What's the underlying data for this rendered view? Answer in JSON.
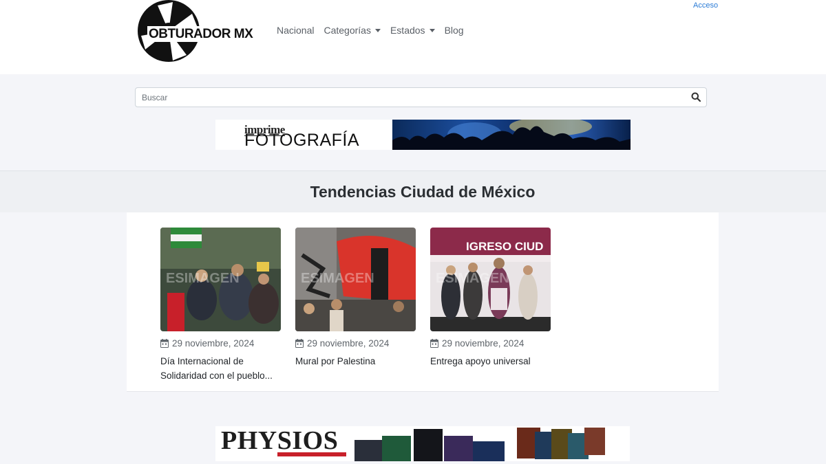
{
  "header": {
    "logo_text": "OBTURADOR MX",
    "login_label": "Acceso",
    "nav": [
      {
        "label": "Nacional",
        "has_dropdown": false
      },
      {
        "label": "Categorías",
        "has_dropdown": true
      },
      {
        "label": "Estados",
        "has_dropdown": true
      },
      {
        "label": "Blog",
        "has_dropdown": false
      }
    ]
  },
  "search": {
    "placeholder": "Buscar",
    "value": ""
  },
  "banners": {
    "top": {
      "small_text": "imprime",
      "big_text": "FOTOGRAFÍA"
    },
    "bottom": {
      "brand_text": "PHYSIOS"
    }
  },
  "section": {
    "title": "Tendencias Ciudad de México"
  },
  "cards": [
    {
      "date": "29 noviembre, 2024",
      "title": "Día Internacional de Solidaridad con el pueblo..."
    },
    {
      "date": "29 noviembre, 2024",
      "title": "Mural por Palestina"
    },
    {
      "date": "29 noviembre, 2024",
      "title": "Entrega apoyo universal"
    }
  ],
  "colors": {
    "accent_link": "#2a7bd6",
    "page_background": "#f4f5f9",
    "nav_text": "#5a5f66"
  },
  "icons": [
    "aperture-logo-icon",
    "caret-down-icon",
    "search-icon",
    "calendar-icon"
  ]
}
